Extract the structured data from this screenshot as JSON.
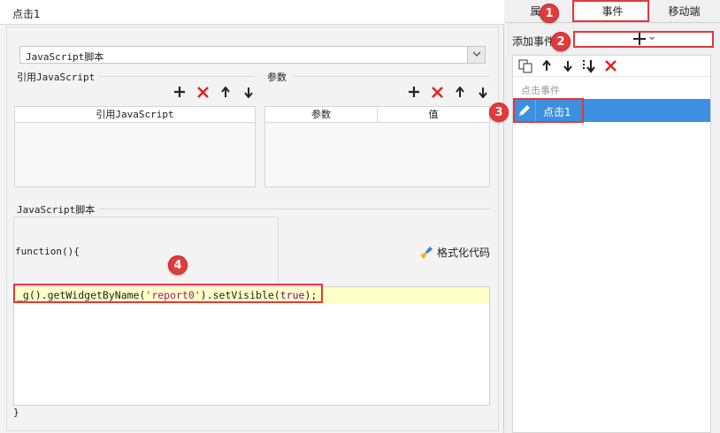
{
  "left_panel": {
    "title": "点击1",
    "script_type": "JavaScript脚本",
    "ref_js_group": "引用JavaScript",
    "params_group": "参数",
    "ref_table": {
      "columns": [
        "引用JavaScript"
      ]
    },
    "params_table": {
      "columns": [
        "参数",
        "值"
      ]
    },
    "script_group": "JavaScript脚本",
    "function_header": "function(){",
    "format_button": "格式化代码",
    "code_line": {
      "p1": "_g().getWidgetByName(",
      "str": "'report0'",
      "p2": ").setVisible(",
      "kw": "true",
      "p3": ");"
    },
    "closing_brace": "}"
  },
  "right_panel": {
    "tabs": [
      "属性",
      "事件",
      "移动端"
    ],
    "active_tab": "事件",
    "add_event_label": "添加事件",
    "category_label": "点击事件",
    "event_item": "点击1"
  },
  "annotations": [
    "1",
    "2",
    "3",
    "4"
  ],
  "colors": {
    "accent_blue": "#3d8fe0",
    "highlight_red": "#e2383a",
    "code_line_bg": "#ffffc8",
    "delete_red": "#e02020"
  }
}
